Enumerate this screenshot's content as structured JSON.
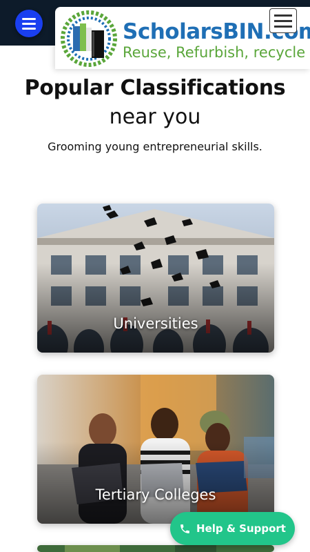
{
  "header": {
    "menu_icon": "menu-icon",
    "logo": {
      "title": "ScholarsBIN.com",
      "tagline": "Reuse, Refurbish, recycle"
    },
    "nav_toggle_icon": "hamburger-icon"
  },
  "intro": {
    "heading": "Popular Classifications",
    "subheading": "near you",
    "tagline": "Grooming young entrepreneurial skills."
  },
  "categories": [
    {
      "label": "Universities",
      "image": "graduation-caps-thrown-in-air"
    },
    {
      "label": "Tertiary Colleges",
      "image": "students-with-laptops"
    },
    {
      "label": "",
      "image": "trees"
    }
  ],
  "help_button": {
    "label": "Help & Support",
    "icon": "phone-icon"
  },
  "colors": {
    "topbar": "#0d1b2a",
    "menu_fab": "#1a3ff0",
    "logo_blue": "#1f6fb5",
    "logo_green": "#5aa63a",
    "help_green": "#22c58a"
  }
}
